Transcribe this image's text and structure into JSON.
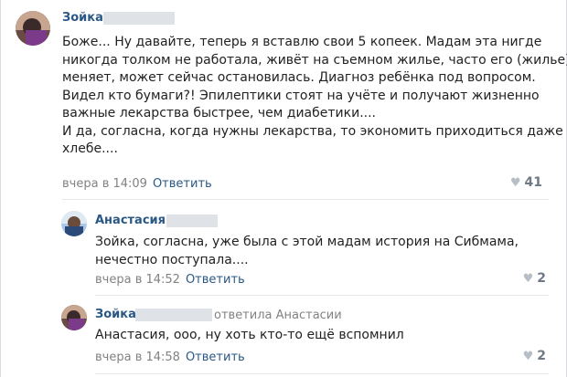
{
  "comments": [
    {
      "author": "Зойка",
      "reply_to": "",
      "text_lines": [
        "Боже... Ну давайте, теперь я вставлю свои 5 копеек. Мадам эта нигде",
        "никогда толком не работала, живёт на съемном жилье, часто его (жилье)",
        "меняет, может сейчас остановилась. Диагноз ребёнка под вопросом.",
        "Видел кто бумаги?! Эпилептики стоят на учёте и получают жизненно",
        "важные лекарства быстрее, чем диабетики....",
        "И да, согласна, когда нужны лекарства, то экономить приходиться даже на",
        "хлебе...."
      ],
      "time": "вчера в 14:09",
      "reply_label": "Ответить",
      "likes": "41",
      "heart_icon": "heart-icon"
    },
    {
      "author": "Анастасия",
      "reply_to": "",
      "text_lines": [
        "Зойка, согласна, уже была с этой мадам история на Сибмама,",
        "нечестно поступала...."
      ],
      "time": "вчера в 14:52",
      "reply_label": "Ответить",
      "likes": "2",
      "heart_icon": "heart-icon"
    },
    {
      "author": "Зойка",
      "reply_to": "ответила Анастасии",
      "text_lines": [
        "Анастасия, ооо, ну хоть кто-то ещё вспомнил"
      ],
      "time": "вчера в 14:58",
      "reply_label": "Ответить",
      "likes": "2",
      "heart_icon": "heart-icon"
    }
  ],
  "colors": {
    "link": "#2a5885",
    "meta": "#828282",
    "heart": "#b7bec6"
  }
}
